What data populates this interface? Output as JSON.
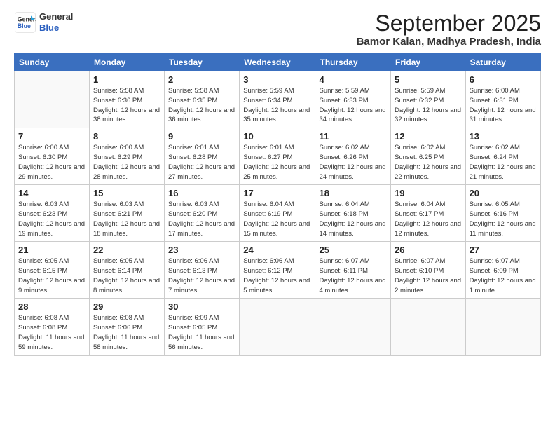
{
  "logo": {
    "line1": "General",
    "line2": "Blue"
  },
  "title": "September 2025",
  "location": "Bamor Kalan, Madhya Pradesh, India",
  "days_header": [
    "Sunday",
    "Monday",
    "Tuesday",
    "Wednesday",
    "Thursday",
    "Friday",
    "Saturday"
  ],
  "weeks": [
    [
      {
        "num": "",
        "info": ""
      },
      {
        "num": "1",
        "info": "Sunrise: 5:58 AM\nSunset: 6:36 PM\nDaylight: 12 hours\nand 38 minutes."
      },
      {
        "num": "2",
        "info": "Sunrise: 5:58 AM\nSunset: 6:35 PM\nDaylight: 12 hours\nand 36 minutes."
      },
      {
        "num": "3",
        "info": "Sunrise: 5:59 AM\nSunset: 6:34 PM\nDaylight: 12 hours\nand 35 minutes."
      },
      {
        "num": "4",
        "info": "Sunrise: 5:59 AM\nSunset: 6:33 PM\nDaylight: 12 hours\nand 34 minutes."
      },
      {
        "num": "5",
        "info": "Sunrise: 5:59 AM\nSunset: 6:32 PM\nDaylight: 12 hours\nand 32 minutes."
      },
      {
        "num": "6",
        "info": "Sunrise: 6:00 AM\nSunset: 6:31 PM\nDaylight: 12 hours\nand 31 minutes."
      }
    ],
    [
      {
        "num": "7",
        "info": "Sunrise: 6:00 AM\nSunset: 6:30 PM\nDaylight: 12 hours\nand 29 minutes."
      },
      {
        "num": "8",
        "info": "Sunrise: 6:00 AM\nSunset: 6:29 PM\nDaylight: 12 hours\nand 28 minutes."
      },
      {
        "num": "9",
        "info": "Sunrise: 6:01 AM\nSunset: 6:28 PM\nDaylight: 12 hours\nand 27 minutes."
      },
      {
        "num": "10",
        "info": "Sunrise: 6:01 AM\nSunset: 6:27 PM\nDaylight: 12 hours\nand 25 minutes."
      },
      {
        "num": "11",
        "info": "Sunrise: 6:02 AM\nSunset: 6:26 PM\nDaylight: 12 hours\nand 24 minutes."
      },
      {
        "num": "12",
        "info": "Sunrise: 6:02 AM\nSunset: 6:25 PM\nDaylight: 12 hours\nand 22 minutes."
      },
      {
        "num": "13",
        "info": "Sunrise: 6:02 AM\nSunset: 6:24 PM\nDaylight: 12 hours\nand 21 minutes."
      }
    ],
    [
      {
        "num": "14",
        "info": "Sunrise: 6:03 AM\nSunset: 6:23 PM\nDaylight: 12 hours\nand 19 minutes."
      },
      {
        "num": "15",
        "info": "Sunrise: 6:03 AM\nSunset: 6:21 PM\nDaylight: 12 hours\nand 18 minutes."
      },
      {
        "num": "16",
        "info": "Sunrise: 6:03 AM\nSunset: 6:20 PM\nDaylight: 12 hours\nand 17 minutes."
      },
      {
        "num": "17",
        "info": "Sunrise: 6:04 AM\nSunset: 6:19 PM\nDaylight: 12 hours\nand 15 minutes."
      },
      {
        "num": "18",
        "info": "Sunrise: 6:04 AM\nSunset: 6:18 PM\nDaylight: 12 hours\nand 14 minutes."
      },
      {
        "num": "19",
        "info": "Sunrise: 6:04 AM\nSunset: 6:17 PM\nDaylight: 12 hours\nand 12 minutes."
      },
      {
        "num": "20",
        "info": "Sunrise: 6:05 AM\nSunset: 6:16 PM\nDaylight: 12 hours\nand 11 minutes."
      }
    ],
    [
      {
        "num": "21",
        "info": "Sunrise: 6:05 AM\nSunset: 6:15 PM\nDaylight: 12 hours\nand 9 minutes."
      },
      {
        "num": "22",
        "info": "Sunrise: 6:05 AM\nSunset: 6:14 PM\nDaylight: 12 hours\nand 8 minutes."
      },
      {
        "num": "23",
        "info": "Sunrise: 6:06 AM\nSunset: 6:13 PM\nDaylight: 12 hours\nand 7 minutes."
      },
      {
        "num": "24",
        "info": "Sunrise: 6:06 AM\nSunset: 6:12 PM\nDaylight: 12 hours\nand 5 minutes."
      },
      {
        "num": "25",
        "info": "Sunrise: 6:07 AM\nSunset: 6:11 PM\nDaylight: 12 hours\nand 4 minutes."
      },
      {
        "num": "26",
        "info": "Sunrise: 6:07 AM\nSunset: 6:10 PM\nDaylight: 12 hours\nand 2 minutes."
      },
      {
        "num": "27",
        "info": "Sunrise: 6:07 AM\nSunset: 6:09 PM\nDaylight: 12 hours\nand 1 minute."
      }
    ],
    [
      {
        "num": "28",
        "info": "Sunrise: 6:08 AM\nSunset: 6:08 PM\nDaylight: 11 hours\nand 59 minutes."
      },
      {
        "num": "29",
        "info": "Sunrise: 6:08 AM\nSunset: 6:06 PM\nDaylight: 11 hours\nand 58 minutes."
      },
      {
        "num": "30",
        "info": "Sunrise: 6:09 AM\nSunset: 6:05 PM\nDaylight: 11 hours\nand 56 minutes."
      },
      {
        "num": "",
        "info": ""
      },
      {
        "num": "",
        "info": ""
      },
      {
        "num": "",
        "info": ""
      },
      {
        "num": "",
        "info": ""
      }
    ]
  ]
}
